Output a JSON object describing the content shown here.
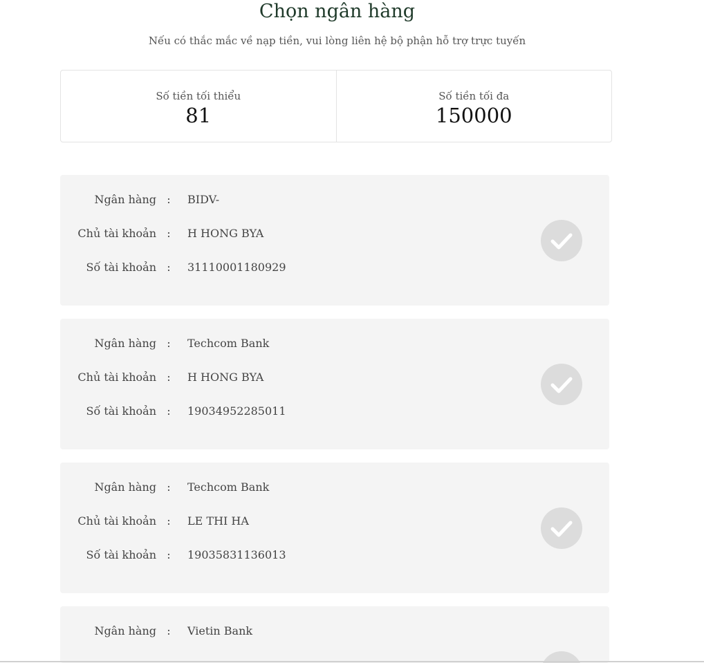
{
  "header": {
    "title": "Chọn ngân hàng",
    "subtitle": "Nếu có thắc mắc về nạp tiền, vui lòng liên hệ bộ phận hỗ trợ trực tuyến"
  },
  "limits": {
    "min_label": "Số tiền tối thiểu",
    "min_value": "81",
    "max_label": "Số tiền tối đa",
    "max_value": "150000"
  },
  "labels": {
    "bank": "Ngân hàng",
    "holder": "Chủ tài khoản",
    "account": "Số tài khoản",
    "colon": ":"
  },
  "banks": [
    {
      "bank": "BIDV-",
      "holder": "H HONG BYA",
      "account": "31110001180929"
    },
    {
      "bank": "Techcom Bank",
      "holder": "H HONG BYA",
      "account": "19034952285011"
    },
    {
      "bank": "Techcom Bank",
      "holder": "LE THI HA",
      "account": "19035831136013"
    },
    {
      "bank": "Vietin Bank",
      "holder": "",
      "account": ""
    }
  ],
  "icons": {
    "select": "check-icon"
  }
}
